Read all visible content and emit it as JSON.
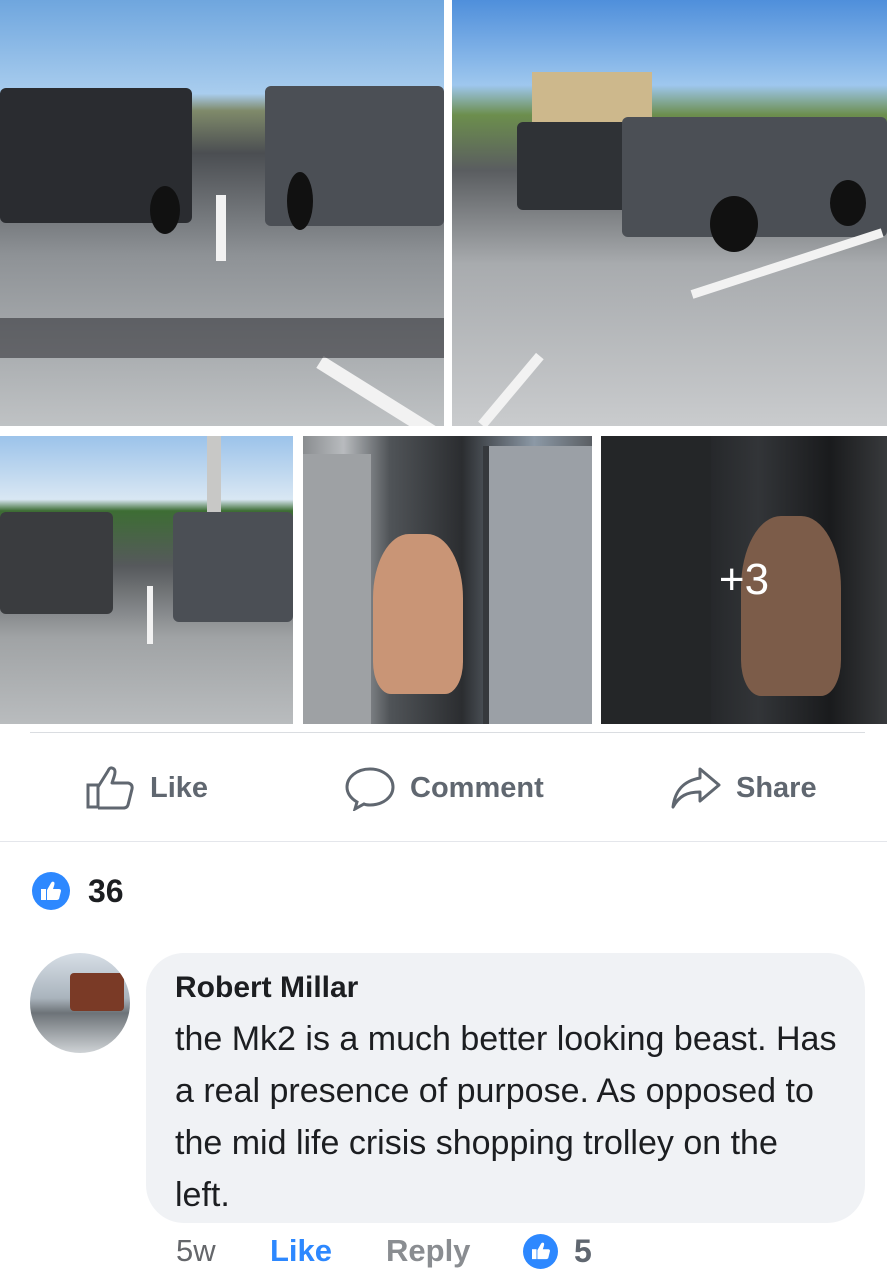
{
  "post": {
    "photos": [
      {
        "caption": "photo-1"
      },
      {
        "caption": "photo-2"
      },
      {
        "caption": "photo-3"
      },
      {
        "caption": "photo-4"
      },
      {
        "caption": "photo-5",
        "more_overlay": "+3"
      }
    ],
    "actions": {
      "like_label": "Like",
      "comment_label": "Comment",
      "share_label": "Share"
    },
    "reactions": {
      "count": "36",
      "icon": "thumbs-up-icon",
      "color": "#2d88ff"
    }
  },
  "comment": {
    "author": "Robert Millar",
    "text": "the Mk2 is a much better looking beast. Has a real presence of purpose. As opposed to the mid life crisis shopping trolley on the left.",
    "time": "5w",
    "like_label": "Like",
    "reply_label": "Reply",
    "reaction_count": "5"
  }
}
